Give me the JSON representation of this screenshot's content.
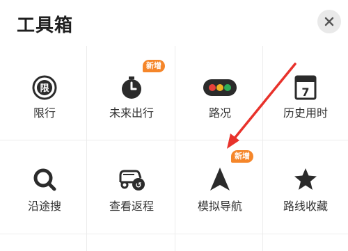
{
  "header": {
    "title": "工具箱"
  },
  "tools": [
    {
      "label": "限行",
      "icon": "restriction-icon"
    },
    {
      "label": "未来出行",
      "icon": "timer-icon",
      "badge": "新增"
    },
    {
      "label": "路况",
      "icon": "traffic-light-icon"
    },
    {
      "label": "历史用时",
      "icon": "calendar-icon",
      "icon_text": "7"
    },
    {
      "label": "沿途搜",
      "icon": "search-icon"
    },
    {
      "label": "查看返程",
      "icon": "return-trip-icon"
    },
    {
      "label": "模拟导航",
      "icon": "navigation-arrow-icon",
      "badge": "新增"
    },
    {
      "label": "路线收藏",
      "icon": "star-icon"
    }
  ],
  "colors": {
    "badge": "#f5862a",
    "annotation_arrow": "#e8322b",
    "icon": "#2b2b2b",
    "traffic_red": "#e8413b",
    "traffic_yellow": "#f0b323",
    "traffic_green": "#2fae58"
  }
}
